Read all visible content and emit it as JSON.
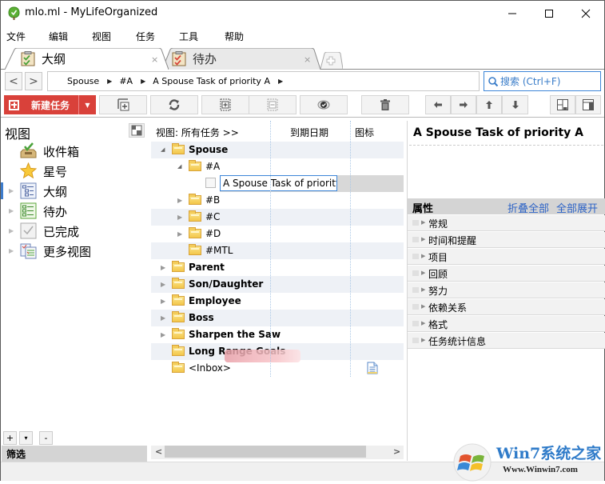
{
  "window": {
    "title": "mlo.ml - MyLifeOrganized",
    "controls": [
      "minimize",
      "maximize",
      "close"
    ]
  },
  "menu": [
    "文件",
    "编辑",
    "视图",
    "任务",
    "工具",
    "帮助"
  ],
  "tabs": [
    {
      "label": "大纲",
      "icon": "outline-checklist-icon",
      "active": true,
      "close": "×"
    },
    {
      "label": "待办",
      "icon": "todo-checklist-icon",
      "active": false,
      "close": "×"
    }
  ],
  "nav": {
    "back": "<",
    "forward": ">",
    "breadcrumb": [
      "Spouse",
      "#A",
      "A Spouse Task of priority A"
    ],
    "search_placeholder": "搜索 (Ctrl+F)"
  },
  "toolbar": {
    "new_task_label": "新建任务",
    "buttons": [
      "add-subtask",
      "refresh",
      "expand-all",
      "collapse-all",
      "show-completed",
      "delete",
      "move-left",
      "move-right",
      "move-up",
      "move-down",
      "layout-1",
      "layout-2"
    ]
  },
  "views": {
    "header": "视图",
    "items": [
      {
        "label": "收件箱",
        "icon": "inbox-icon",
        "expandable": false,
        "selected": false
      },
      {
        "label": "星号",
        "icon": "star-icon",
        "expandable": false,
        "selected": false
      },
      {
        "label": "大纲",
        "icon": "outline-icon",
        "expandable": true,
        "selected": true
      },
      {
        "label": "待办",
        "icon": "todo-icon",
        "expandable": true,
        "selected": false
      },
      {
        "label": "已完成",
        "icon": "completed-icon",
        "expandable": true,
        "selected": false
      },
      {
        "label": "更多视图",
        "icon": "more-views-icon",
        "expandable": true,
        "selected": false
      }
    ],
    "filter_buttons": [
      "+",
      "▾",
      "-"
    ],
    "filter_label": "筛选"
  },
  "tree": {
    "columns": [
      "视图: 所有任务 >>",
      "到期日期",
      "图标"
    ],
    "rows": [
      {
        "label": "Spouse",
        "level": 0,
        "bold": true,
        "expander": "expanded",
        "type": "folder"
      },
      {
        "label": "#A",
        "level": 1,
        "bold": false,
        "expander": "expanded",
        "type": "folder"
      },
      {
        "label": "A Spouse Task of priority A",
        "level": 2,
        "bold": false,
        "expander": "none",
        "type": "task",
        "editing": true,
        "selected": true
      },
      {
        "label": "#B",
        "level": 1,
        "bold": false,
        "expander": "collapsed",
        "type": "folder"
      },
      {
        "label": "#C",
        "level": 1,
        "bold": false,
        "expander": "collapsed",
        "type": "folder"
      },
      {
        "label": "#D",
        "level": 1,
        "bold": false,
        "expander": "collapsed",
        "type": "folder",
        "obscured": true
      },
      {
        "label": "#MTL",
        "level": 1,
        "bold": false,
        "expander": "none",
        "type": "folder"
      },
      {
        "label": "Parent",
        "level": 0,
        "bold": true,
        "expander": "collapsed",
        "type": "folder"
      },
      {
        "label": "Son/Daughter",
        "level": 0,
        "bold": true,
        "expander": "collapsed",
        "type": "folder"
      },
      {
        "label": "Employee",
        "level": 0,
        "bold": true,
        "expander": "collapsed",
        "type": "folder"
      },
      {
        "label": "Boss",
        "level": 0,
        "bold": true,
        "expander": "collapsed",
        "type": "folder"
      },
      {
        "label": "Sharpen the Saw",
        "level": 0,
        "bold": true,
        "expander": "collapsed",
        "type": "folder"
      },
      {
        "label": "Long Range Goals",
        "level": 0,
        "bold": true,
        "expander": "none",
        "type": "folder"
      },
      {
        "label": "<Inbox>",
        "level": 0,
        "bold": false,
        "expander": "none",
        "type": "folder",
        "has_note_icon": true
      }
    ]
  },
  "details": {
    "title": "A Spouse Task of priority A",
    "properties_label": "属性",
    "collapse_all": "折叠全部",
    "expand_all": "全部展开",
    "sections": [
      "常规",
      "时间和提醒",
      "项目",
      "回顾",
      "努力",
      "依赖关系",
      "格式",
      "任务统计信息"
    ]
  },
  "watermark": {
    "brand": "Win7系统之家",
    "url": "Www.Winwin7.com"
  },
  "colors": {
    "accent_blue": "#3d86d8",
    "new_task_red": "#d9413a",
    "link_blue": "#2b62c6"
  }
}
